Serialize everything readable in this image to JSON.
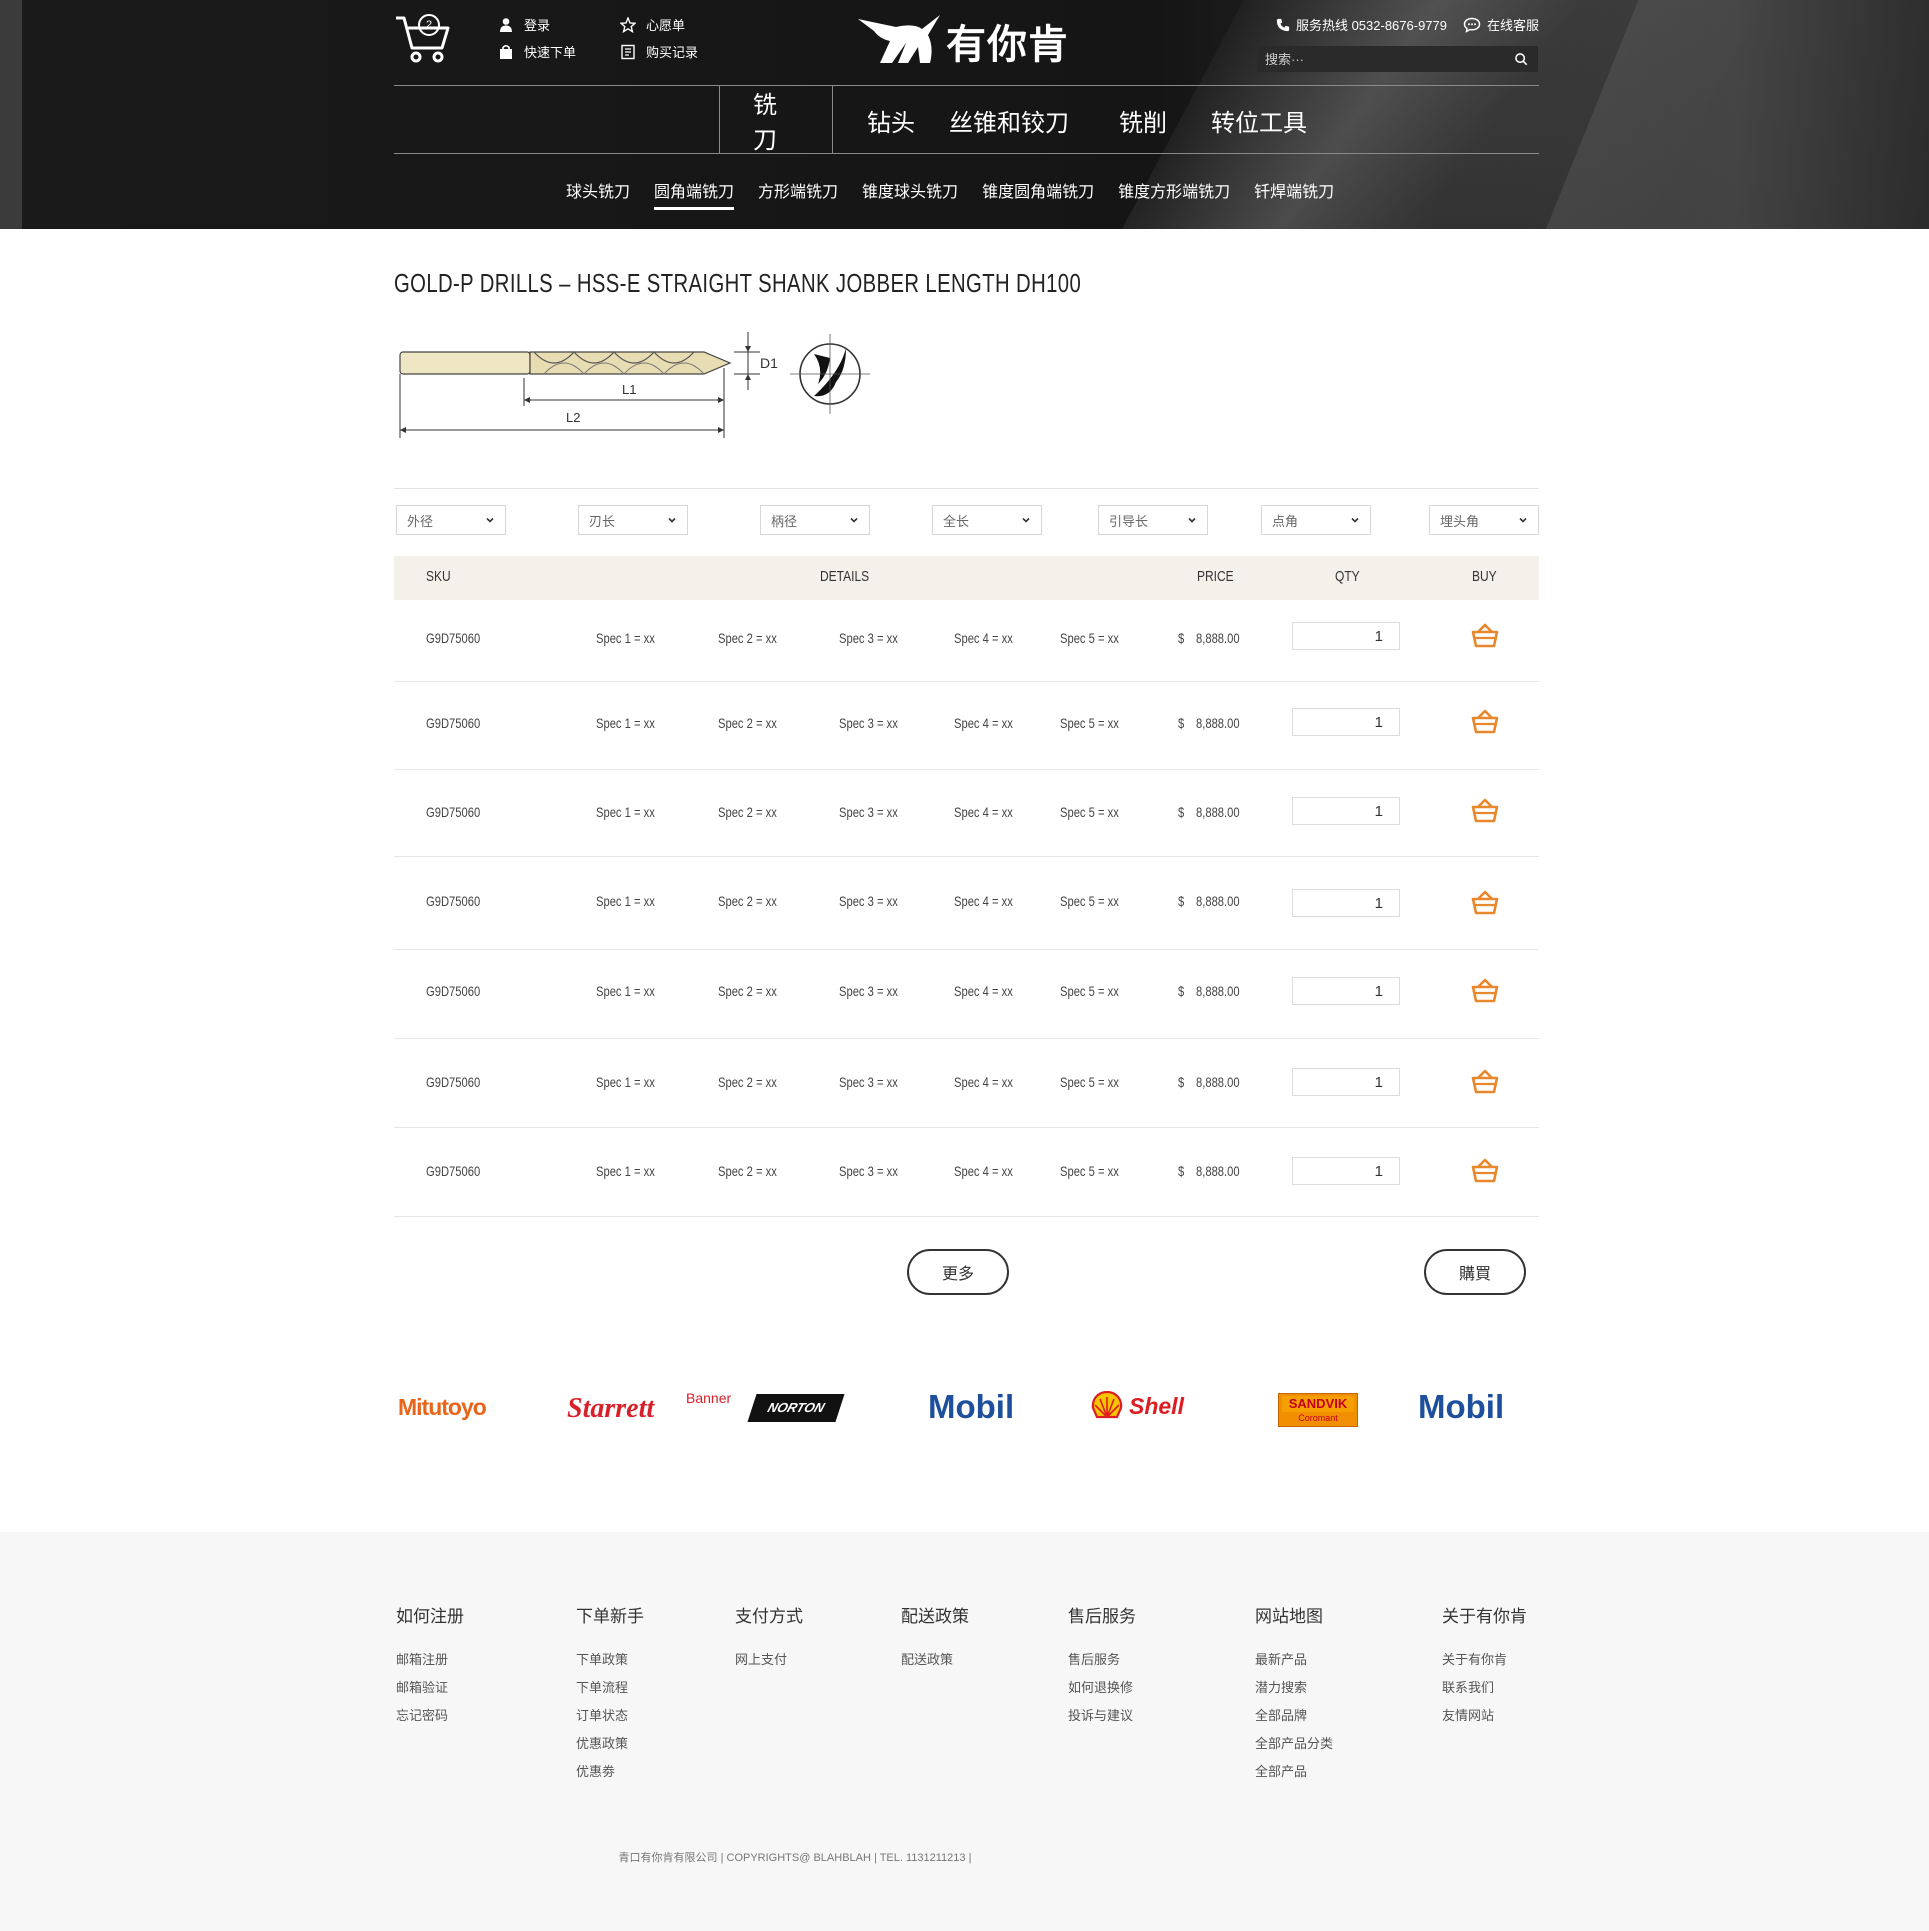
{
  "header": {
    "cart_count": "2",
    "links": {
      "login": "登录",
      "quick_order": "快速下单",
      "wishlist": "心愿单",
      "purchase_history": "购买记录"
    },
    "logo_text": "有你肯",
    "hotline": "服务热线 0532-8676-9779",
    "online_service": "在线客服",
    "search_placeholder": "搜索···"
  },
  "main_nav": [
    "铣刀",
    "钻头",
    "丝锥和铰刀",
    "铣削",
    "转位工具"
  ],
  "sub_nav": [
    "球头铣刀",
    "圆角端铣刀",
    "方形端铣刀",
    "锥度球头铣刀",
    "锥度圆角端铣刀",
    "锥度方形端铣刀",
    "钎焊端铣刀"
  ],
  "product": {
    "title": "GOLD-P DRILLS – HSS-E STRAIGHT SHANK JOBBER LENGTH DH100",
    "diagram_labels": {
      "d1": "D1",
      "l1": "L1",
      "l2": "L2"
    }
  },
  "filters": [
    "外径",
    "刃长",
    "柄径",
    "全长",
    "引导长",
    "点角",
    "埋头角"
  ],
  "table": {
    "headers": {
      "sku": "SKU",
      "details": "DETAILS",
      "price": "PRICE",
      "qty": "QTY",
      "buy": "BUY"
    },
    "rows": [
      {
        "sku": "G9D75060",
        "spec1": "Spec 1 = xx",
        "spec2": "Spec 2 = xx",
        "spec3": "Spec 3 = xx",
        "spec4": "Spec 4 = xx",
        "spec5": "Spec 5 = xx",
        "currency": "$",
        "price": "8,888.00",
        "qty": "1"
      },
      {
        "sku": "G9D75060",
        "spec1": "Spec 1 = xx",
        "spec2": "Spec 2 = xx",
        "spec3": "Spec 3 = xx",
        "spec4": "Spec 4 = xx",
        "spec5": "Spec 5 = xx",
        "currency": "$",
        "price": "8,888.00",
        "qty": "1"
      },
      {
        "sku": "G9D75060",
        "spec1": "Spec 1 = xx",
        "spec2": "Spec 2 = xx",
        "spec3": "Spec 3 = xx",
        "spec4": "Spec 4 = xx",
        "spec5": "Spec 5 = xx",
        "currency": "$",
        "price": "8,888.00",
        "qty": "1"
      },
      {
        "sku": "G9D75060",
        "spec1": "Spec 1 = xx",
        "spec2": "Spec 2 = xx",
        "spec3": "Spec 3 = xx",
        "spec4": "Spec 4 = xx",
        "spec5": "Spec 5 = xx",
        "currency": "$",
        "price": "8,888.00",
        "qty": "1"
      },
      {
        "sku": "G9D75060",
        "spec1": "Spec 1 = xx",
        "spec2": "Spec 2 = xx",
        "spec3": "Spec 3 = xx",
        "spec4": "Spec 4 = xx",
        "spec5": "Spec 5 = xx",
        "currency": "$",
        "price": "8,888.00",
        "qty": "1"
      },
      {
        "sku": "G9D75060",
        "spec1": "Spec 1 = xx",
        "spec2": "Spec 2 = xx",
        "spec3": "Spec 3 = xx",
        "spec4": "Spec 4 = xx",
        "spec5": "Spec 5 = xx",
        "currency": "$",
        "price": "8,888.00",
        "qty": "1"
      },
      {
        "sku": "G9D75060",
        "spec1": "Spec 1 = xx",
        "spec2": "Spec 2 = xx",
        "spec3": "Spec 3 = xx",
        "spec4": "Spec 4 = xx",
        "spec5": "Spec 5 = xx",
        "currency": "$",
        "price": "8,888.00",
        "qty": "1"
      }
    ]
  },
  "buttons": {
    "more": "更多",
    "buy": "購買"
  },
  "brands": [
    "Mitutoyo",
    "Starrett",
    "Banner",
    "NORTON",
    "Mobil",
    "Shell",
    "SANDVIK",
    "Coromant",
    "Mobil"
  ],
  "footer": {
    "columns": [
      {
        "title": "如何注册",
        "links": [
          "邮箱注册",
          "邮箱验证",
          "忘记密码"
        ]
      },
      {
        "title": "下单新手",
        "links": [
          "下单政策",
          "下单流程",
          "订单状态",
          "优惠政策",
          "优惠劵"
        ]
      },
      {
        "title": "支付方式",
        "links": [
          "网上支付"
        ]
      },
      {
        "title": "配送政策",
        "links": [
          "配送政策"
        ]
      },
      {
        "title": "售后服务",
        "links": [
          "售后服务",
          "如何退换修",
          "投诉与建议"
        ]
      },
      {
        "title": "网站地图",
        "links": [
          "最新产品",
          "潜力搜索",
          "全部品牌",
          "全部产品分类",
          "全部产品"
        ]
      },
      {
        "title": "关于有你肯",
        "links": [
          "关于有你肯",
          "联系我们",
          "友情网站"
        ]
      }
    ],
    "copyright": "青口有你肯有限公司 | COPYRIGHTS@ BLAHBLAH | TEL. 1131211213 |"
  },
  "colors": {
    "accent_orange": "#e8872b",
    "header_bg": "#1a1a1a",
    "table_header_bg": "#f3f1ea",
    "footer_bg": "#f7f7f7"
  }
}
